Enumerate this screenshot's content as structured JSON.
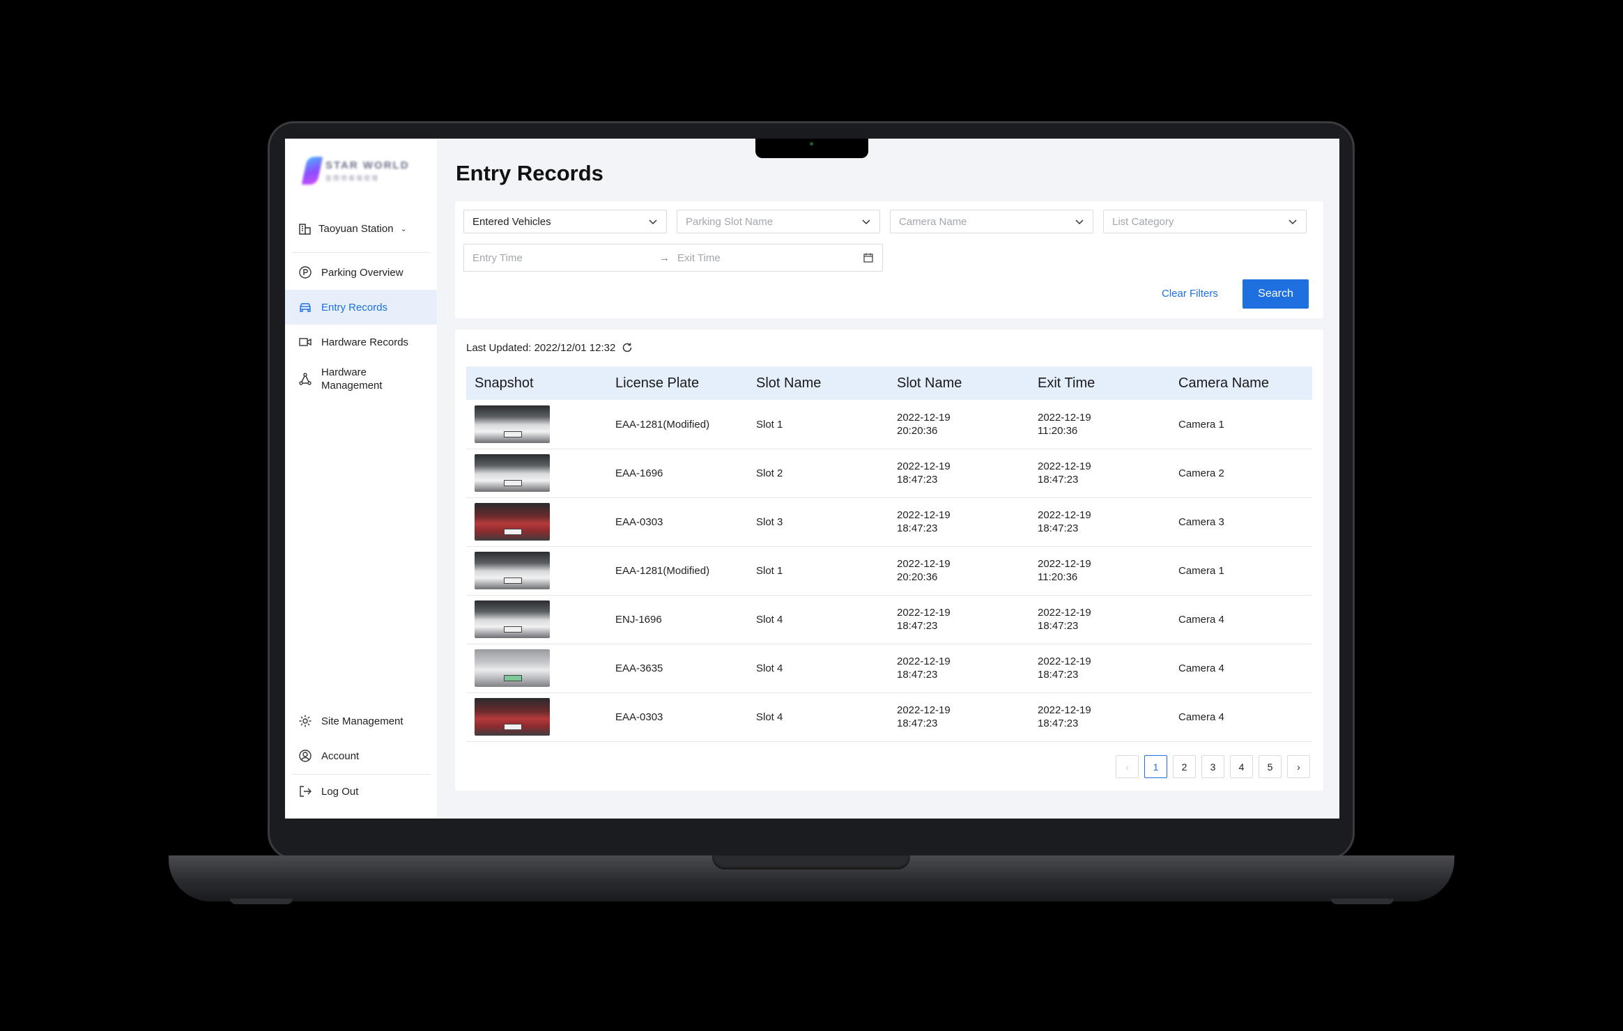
{
  "brand": {
    "logo_line1": "STAR WORLD",
    "logo_line2": "星際停車場管理"
  },
  "site": {
    "name": "Taoyuan Station"
  },
  "nav": {
    "items": [
      {
        "label": "Parking Overview",
        "icon": "parking-icon"
      },
      {
        "label": "Entry Records",
        "icon": "car-icon",
        "active": true
      },
      {
        "label": "Hardware Records",
        "icon": "video-camera-icon"
      },
      {
        "label": "Hardware Management",
        "icon": "network-icon"
      }
    ],
    "bottom": [
      {
        "label": "Site Management",
        "icon": "gear-icon"
      },
      {
        "label": "Account",
        "icon": "user-icon"
      },
      {
        "label": "Log Out",
        "icon": "logout-icon"
      }
    ]
  },
  "page": {
    "title": "Entry Records"
  },
  "filters": {
    "vehicle_type": "Entered Vehicles",
    "parking_slot_placeholder": "Parking Slot Name",
    "camera_placeholder": "Camera Name",
    "list_category_placeholder": "List Category",
    "entry_time_placeholder": "Entry Time",
    "exit_time_placeholder": "Exit Time",
    "range_arrow": "→",
    "clear_label": "Clear Filters",
    "search_label": "Search"
  },
  "table": {
    "last_updated": "Last Updated: 2022/12/01 12:32",
    "headers": [
      "Snapshot",
      "License Plate",
      "Slot Name",
      "Slot Name",
      "Exit Time",
      "Camera Name"
    ],
    "rows": [
      {
        "snapshot": "white",
        "plate": "EAA-1281(Modified)",
        "slot": "Slot 1",
        "entry_date": "2022-12-19",
        "entry_time": "20:20:36",
        "exit_date": "2022-12-19",
        "exit_time": "11:20:36",
        "camera": "Camera 1"
      },
      {
        "snapshot": "white",
        "plate": "EAA-1696",
        "slot": "Slot 2",
        "entry_date": "2022-12-19",
        "entry_time": "18:47:23",
        "exit_date": "2022-12-19",
        "exit_time": "18:47:23",
        "camera": "Camera 2"
      },
      {
        "snapshot": "red",
        "plate": "EAA-0303",
        "slot": "Slot 3",
        "entry_date": "2022-12-19",
        "entry_time": "18:47:23",
        "exit_date": "2022-12-19",
        "exit_time": "18:47:23",
        "camera": "Camera 3"
      },
      {
        "snapshot": "white",
        "plate": "EAA-1281(Modified)",
        "slot": "Slot 1",
        "entry_date": "2022-12-19",
        "entry_time": "20:20:36",
        "exit_date": "2022-12-19",
        "exit_time": "11:20:36",
        "camera": "Camera 1"
      },
      {
        "snapshot": "white",
        "plate": "ENJ-1696",
        "slot": "Slot 4",
        "entry_date": "2022-12-19",
        "entry_time": "18:47:23",
        "exit_date": "2022-12-19",
        "exit_time": "18:47:23",
        "camera": "Camera 4"
      },
      {
        "snapshot": "silver",
        "plate": "EAA-3635",
        "slot": "Slot 4",
        "entry_date": "2022-12-19",
        "entry_time": "18:47:23",
        "exit_date": "2022-12-19",
        "exit_time": "18:47:23",
        "camera": "Camera 4"
      },
      {
        "snapshot": "red",
        "plate": "EAA-0303",
        "slot": "Slot 4",
        "entry_date": "2022-12-19",
        "entry_time": "18:47:23",
        "exit_date": "2022-12-19",
        "exit_time": "18:47:23",
        "camera": "Camera 4"
      }
    ]
  },
  "pagination": {
    "pages": [
      "1",
      "2",
      "3",
      "4",
      "5"
    ],
    "current": "1",
    "prev": "‹",
    "next": "›"
  },
  "colors": {
    "accent": "#1e6fe0",
    "active_nav_bg": "#e7effb",
    "table_header_bg": "#e5eefb",
    "screen_bg": "#f2f4f7"
  }
}
